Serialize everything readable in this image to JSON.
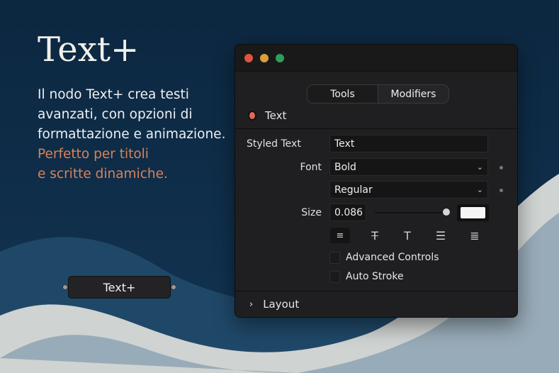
{
  "hero": {
    "title": "Text+",
    "body_lines": [
      "Il nodo Text+ crea testi",
      "avanzati, con opzioni di",
      "formattazione e animazione."
    ],
    "accent_lines": [
      "Perfetto per titoli",
      "e scritte dinamiche."
    ]
  },
  "node": {
    "label": "Text+"
  },
  "window": {
    "tabs": [
      {
        "label": "Tools",
        "active": true
      },
      {
        "label": "Modifiers",
        "active": false
      }
    ],
    "tool_name": "Text",
    "styled_text": {
      "label": "Styled Text",
      "value": "Text"
    },
    "font": {
      "label": "Font",
      "family": "Bold",
      "style": "Regular"
    },
    "size": {
      "label": "Size",
      "value": "0.086",
      "slider_fraction": 0.95
    },
    "color": "#f5f5f5",
    "alignment_icons": [
      "align-center-icon",
      "strikethrough-icon",
      "text-t-icon",
      "align-left-icon",
      "justify-icon"
    ],
    "checkboxes": [
      {
        "label": "Advanced Controls",
        "checked": false
      },
      {
        "label": "Auto Stroke",
        "checked": false
      }
    ],
    "section": "Layout"
  },
  "colors": {
    "accent": "#d9825b",
    "close": "#e0533f",
    "minimize": "#d9a03a",
    "maximize": "#2f9e5a"
  }
}
